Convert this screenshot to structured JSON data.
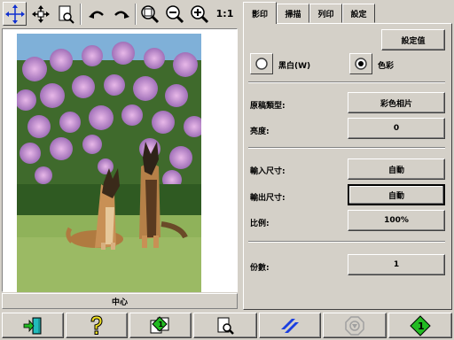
{
  "toolbar": {
    "icons": [
      "move-cursor-icon",
      "pan-icon",
      "page-zoom-icon",
      "undo-icon",
      "redo-icon",
      "zoom-fit-icon",
      "zoom-out-icon",
      "zoom-in-icon",
      "actual-size-icon"
    ],
    "actual_size_label": "1:1"
  },
  "preview": {
    "caption": "中心"
  },
  "tabs": [
    {
      "label": "影印",
      "selected": true
    },
    {
      "label": "掃描",
      "selected": false
    },
    {
      "label": "列印",
      "selected": false
    },
    {
      "label": "設定",
      "selected": false
    }
  ],
  "copy_panel": {
    "settings_button": "設定值",
    "mode": {
      "bw_label": "黑白(W)",
      "color_label": "色彩",
      "selected": "color"
    },
    "rows": [
      {
        "label": "原稿類型:",
        "value": "彩色相片"
      },
      {
        "label": "亮度:",
        "value": "0"
      },
      {
        "label": "輸入尺寸:",
        "value": "自動"
      },
      {
        "label": "輸出尺寸:",
        "value": "自動"
      },
      {
        "label": "比例:",
        "value": "100%"
      },
      {
        "label": "份數:",
        "value": "1"
      }
    ]
  },
  "bottom_bar": {
    "icons": [
      "exit-icon",
      "help-icon",
      "copy-icon",
      "preview-icon",
      "scan-icon",
      "stop-icon",
      "start-icon"
    ],
    "colors": {
      "green": "#22bb22",
      "yellow": "#f0e020",
      "blue": "#1a3fe0",
      "gray": "#a0a0a0"
    }
  }
}
